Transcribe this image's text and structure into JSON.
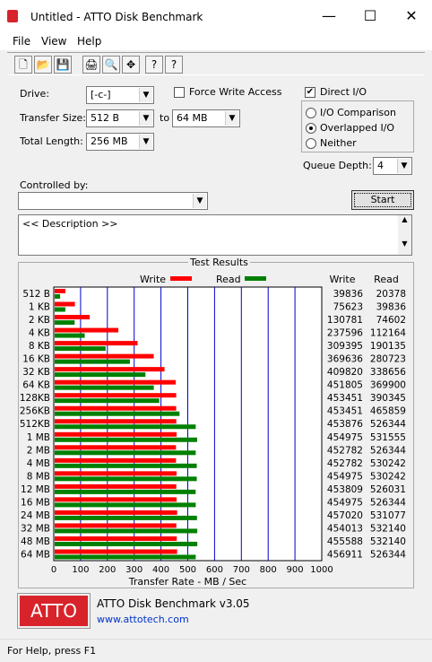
{
  "window": {
    "title": "Untitled - ATTO Disk Benchmark",
    "minimize": "—",
    "maximize": "☐",
    "close": "✕"
  },
  "menu": [
    "File",
    "View",
    "Help"
  ],
  "toolbar": {
    "icons": [
      "new-doc-icon",
      "open-folder-icon",
      "save-icon",
      "print-icon",
      "print-preview-icon",
      "move-icon",
      "help-icon",
      "context-help-icon"
    ],
    "glyphs": [
      "🗋",
      "📂",
      "💾",
      "🖨",
      "🔍",
      "✥",
      "?",
      "?"
    ]
  },
  "form": {
    "drive_label": "Drive:",
    "drive_value": "[-c-]",
    "transfer_label": "Transfer Size:",
    "transfer_from": "512 B",
    "to_label": "to",
    "transfer_to": "64 MB",
    "total_label": "Total Length:",
    "total_value": "256 MB",
    "force_write": "Force Write Access",
    "force_checked": false,
    "direct_io": "Direct I/O",
    "direct_checked": true,
    "io_comparison": "I/O Comparison",
    "overlapped_io": "Overlapped I/O",
    "neither": "Neither",
    "selected_mode": "Overlapped I/O",
    "queue_label": "Queue Depth:",
    "queue_value": "4",
    "controlled_label": "Controlled by:",
    "controlled_value": "",
    "start": "Start",
    "description": "<< Description >>"
  },
  "results_title": "Test Results",
  "chart_data": {
    "type": "bar",
    "orientation": "horizontal",
    "categories": [
      "512 B",
      "1 KB",
      "2 KB",
      "4 KB",
      "8 KB",
      "16 KB",
      "32 KB",
      "64 KB",
      "128KB",
      "256KB",
      "512KB",
      "1 MB",
      "2 MB",
      "4 MB",
      "8 MB",
      "12 MB",
      "16 MB",
      "24 MB",
      "32 MB",
      "48 MB",
      "64 MB"
    ],
    "series": [
      {
        "name": "Write",
        "color": "#ff0000",
        "values": [
          39836,
          75623,
          130781,
          237596,
          309395,
          369636,
          409820,
          451805,
          453451,
          453451,
          453876,
          454975,
          452782,
          452782,
          454975,
          453809,
          454975,
          457020,
          454013,
          455588,
          456911
        ]
      },
      {
        "name": "Read",
        "color": "#008000",
        "values": [
          20378,
          39836,
          74602,
          112164,
          190135,
          280723,
          338656,
          369900,
          390345,
          465859,
          526344,
          531555,
          526344,
          530242,
          530242,
          526031,
          526344,
          531077,
          532140,
          532140,
          526344
        ]
      }
    ],
    "xlabel": "Transfer Rate - MB / Sec",
    "xticks": [
      "0",
      "100",
      "200",
      "300",
      "400",
      "500",
      "600",
      "700",
      "800",
      "900",
      "1000"
    ],
    "xlim": [
      0,
      1000
    ],
    "legend_placement": "top",
    "column_headers": [
      "Write",
      "Read"
    ]
  },
  "footer": {
    "logo": "ATTO",
    "app_name": "ATTO Disk Benchmark v3.05",
    "url": "www.attotech.com"
  },
  "status": "For Help, press F1"
}
